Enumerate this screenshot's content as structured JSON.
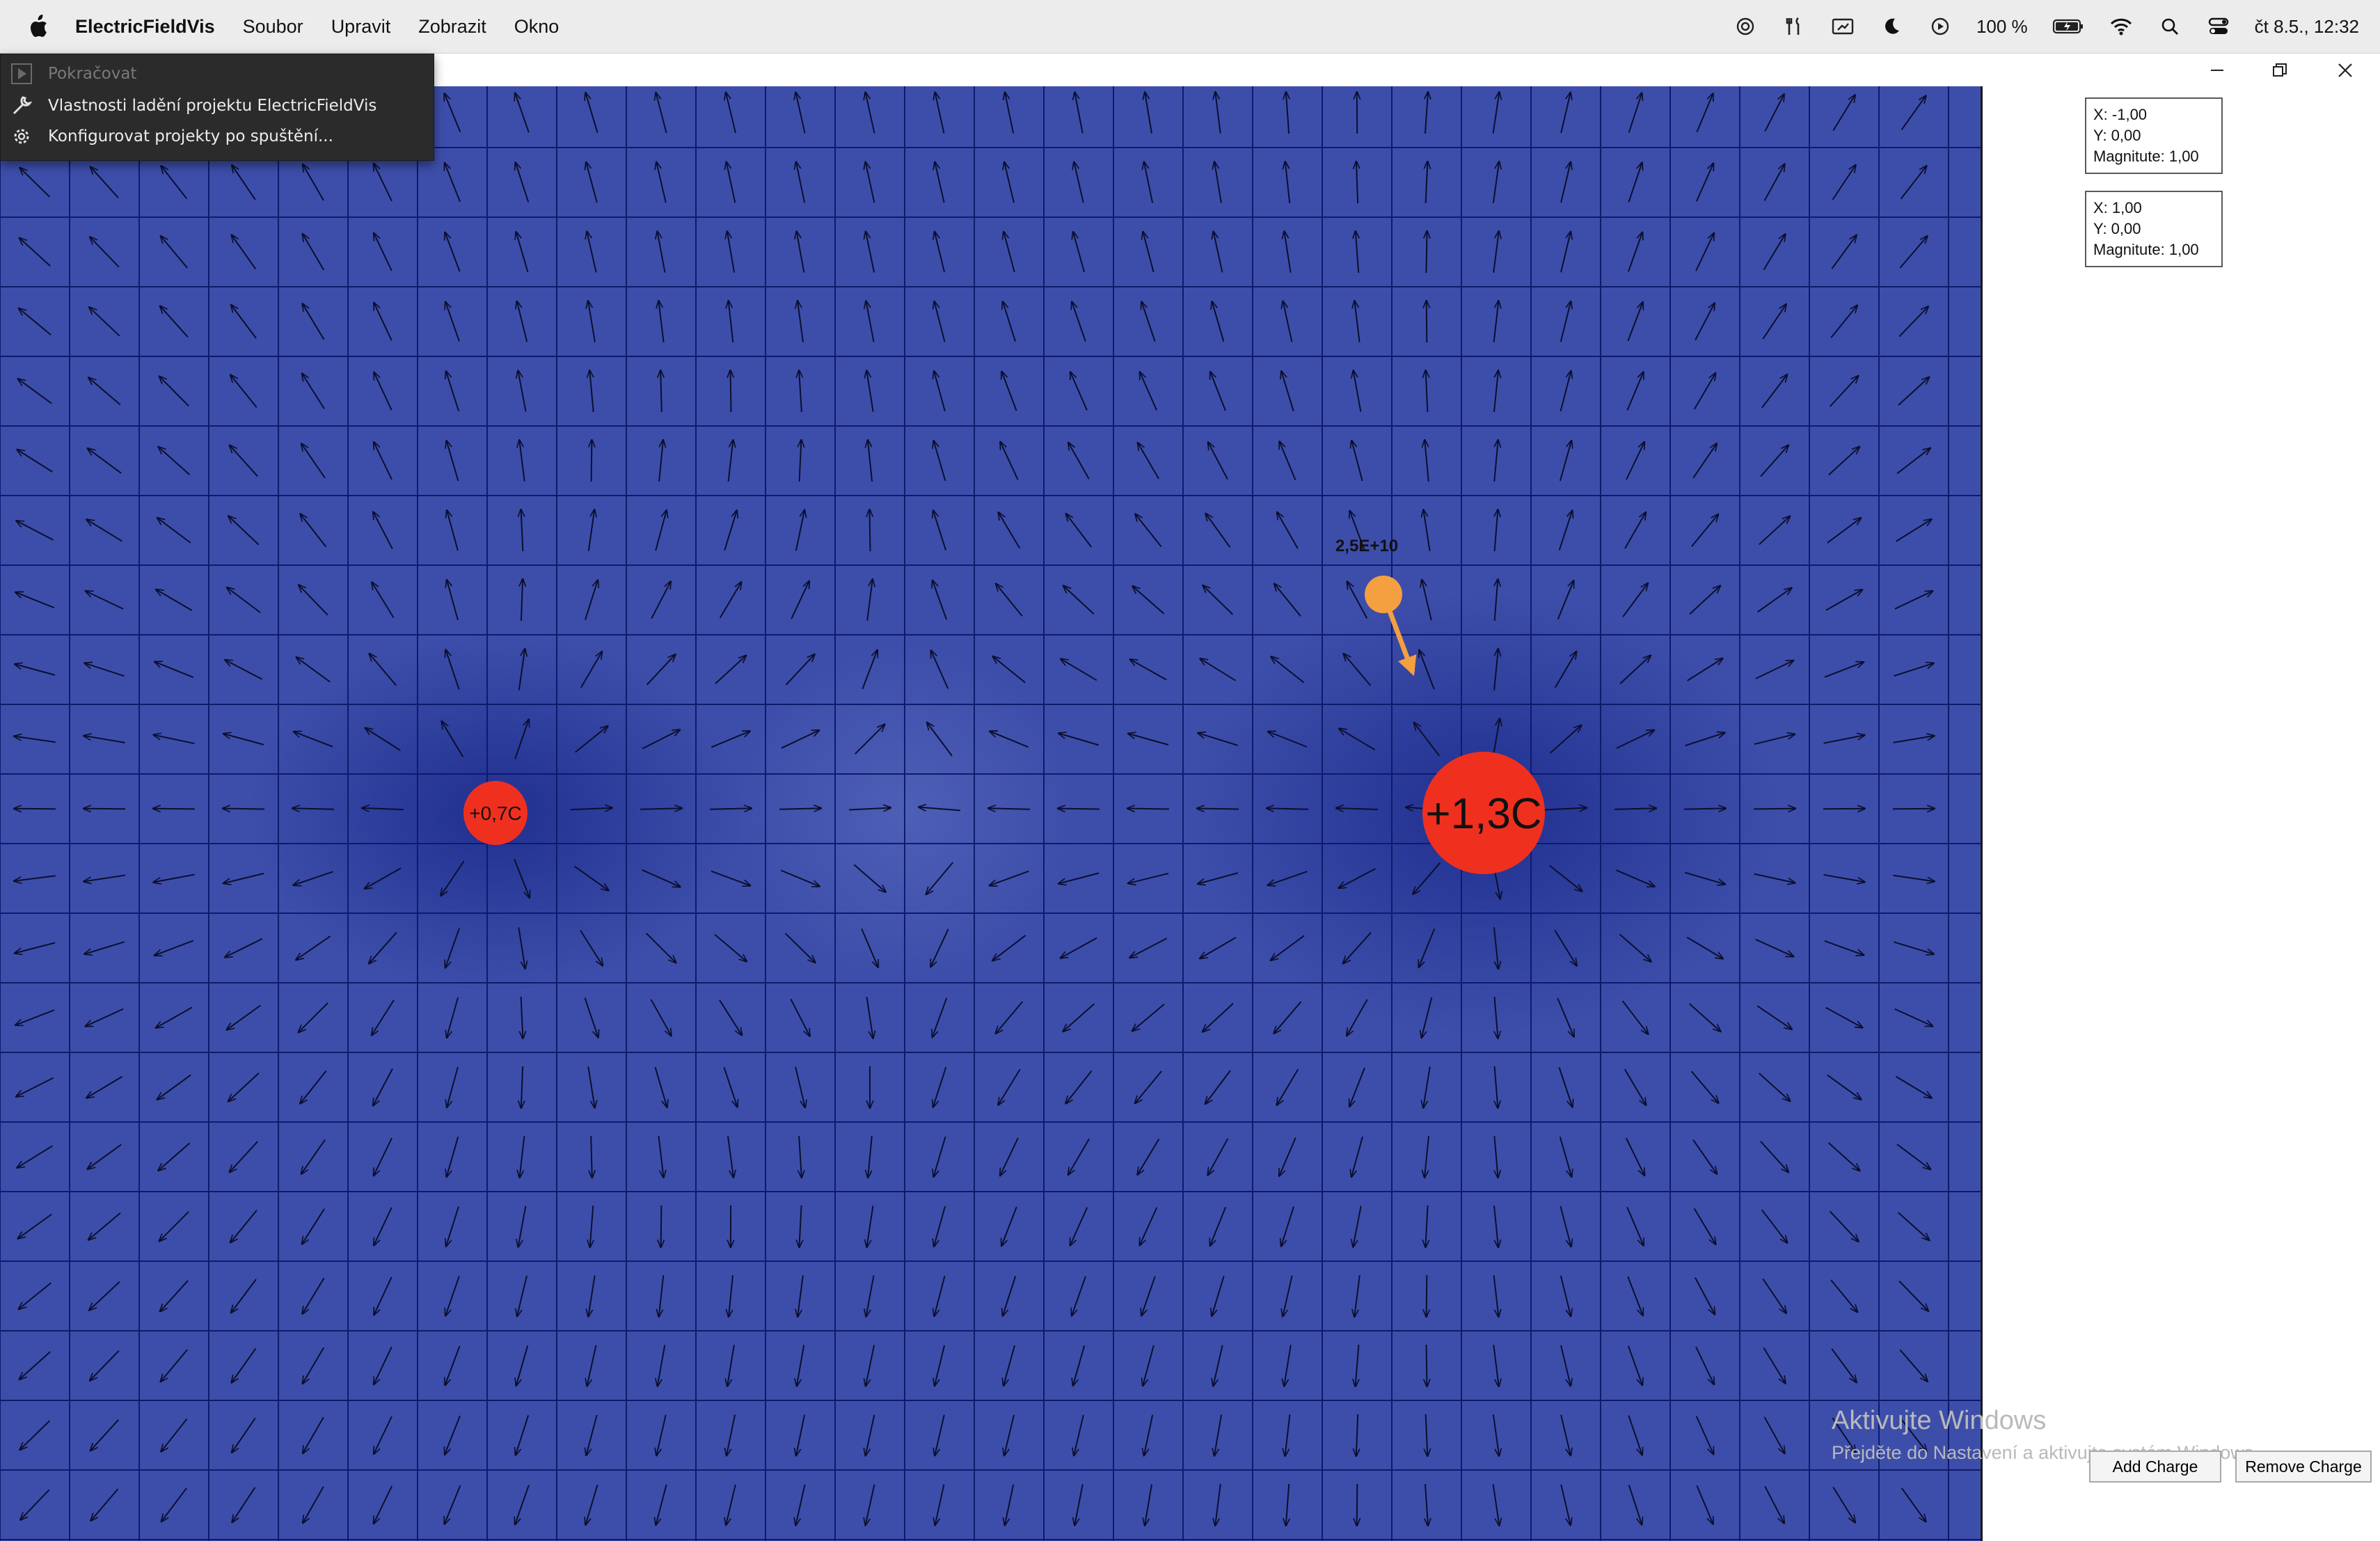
{
  "menubar": {
    "app_name": "ElectricFieldVis",
    "items": [
      "Soubor",
      "Upravit",
      "Zobrazit",
      "Okno"
    ],
    "battery": "100 %",
    "datetime": "čt 8.5., 12:32",
    "status_icons": [
      "chatgpt-icon",
      "tools-icon",
      "screen-share-icon",
      "moon-icon",
      "play-circle-icon",
      "battery-icon",
      "wifi-icon",
      "search-icon",
      "control-center-icon"
    ]
  },
  "debug_menu": {
    "items": [
      {
        "label": "Pokračovat",
        "icon": "play-icon",
        "enabled": false
      },
      {
        "label": "Vlastnosti ladění projektu ElectricFieldVis",
        "icon": "wrench-icon",
        "enabled": true
      },
      {
        "label": "Konfigurovat projekty po spuštění...",
        "icon": "gear-icon",
        "enabled": true
      }
    ]
  },
  "field": {
    "background_color": "#3d4eaa",
    "grid_color": "#0c1b6c",
    "charges": [
      {
        "label": "+0,7C",
        "color": "#f0301f"
      },
      {
        "label": "+1,3C",
        "color": "#f0301f"
      }
    ],
    "probe": {
      "label": "2,5E+10",
      "color": "#f4a040"
    }
  },
  "info_boxes": [
    {
      "x": "X: -1,00",
      "y": "Y: 0,00",
      "magnitude": "Magnitute: 1,00"
    },
    {
      "x": "X: 1,00",
      "y": "Y: 0,00",
      "magnitude": "Magnitute: 1,00"
    }
  ],
  "buttons": {
    "add": "Add Charge",
    "remove": "Remove Charge"
  },
  "watermark": {
    "title": "Aktivujte Windows",
    "subtitle": "Přejděte do Nastavení a aktivujte systém Windows."
  }
}
